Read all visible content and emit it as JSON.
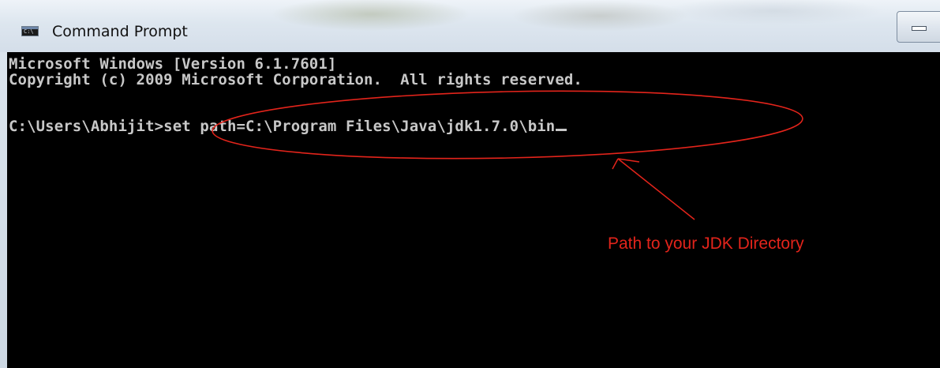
{
  "window": {
    "title": "Command Prompt",
    "icon": "cmd-window-icon",
    "icon_label": "C:\\"
  },
  "console": {
    "lines": [
      "Microsoft Windows [Version 6.1.7601]",
      "Copyright (c) 2009 Microsoft Corporation.  All rights reserved."
    ],
    "prompt": "C:\\Users\\Abhijit>",
    "command": "set path=C:\\Program Files\\Java\\jdk1.7.0\\bin"
  },
  "annotation": {
    "text": "Path to your JDK Directory",
    "color": "#e3241b"
  },
  "colors": {
    "console_bg": "#000000",
    "console_text": "#c8c8c8",
    "annotation": "#e3241b"
  }
}
